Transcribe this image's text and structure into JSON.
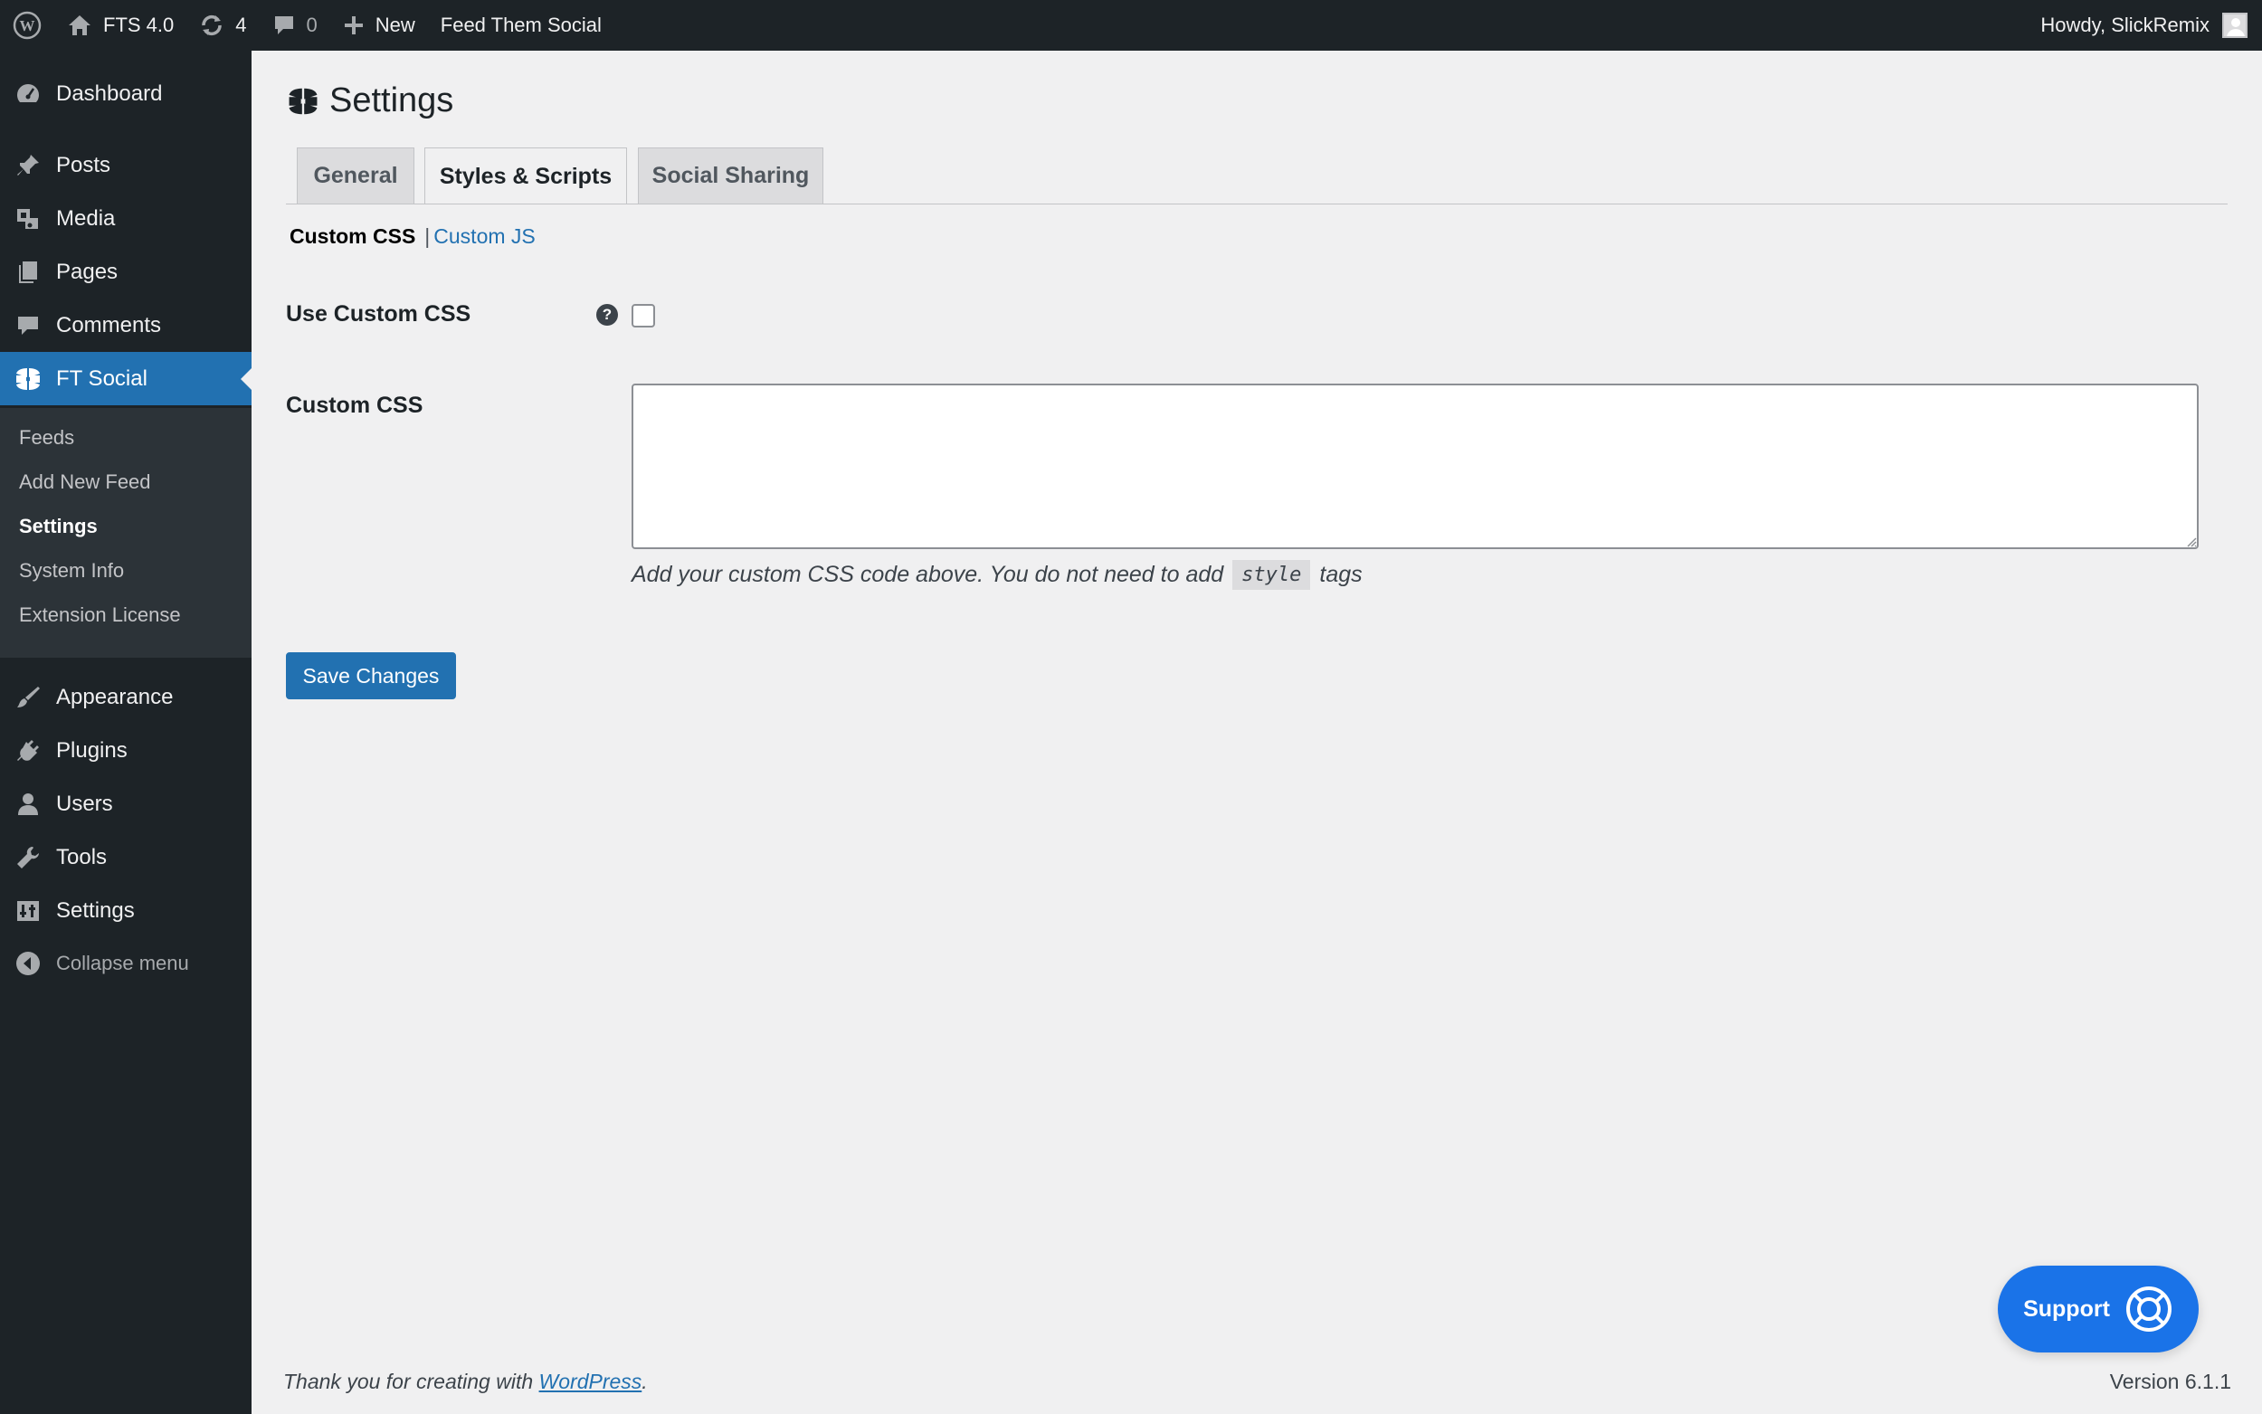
{
  "admin_bar": {
    "site_name": "FTS 4.0",
    "updates_count": "4",
    "comments_count": "0",
    "new_label": "New",
    "plugin_link": "Feed Them Social",
    "greeting": "Howdy, SlickRemix"
  },
  "sidebar": {
    "items": [
      {
        "label": "Dashboard",
        "icon": "dashboard-icon"
      },
      {
        "label": "Posts",
        "icon": "pin-icon"
      },
      {
        "label": "Media",
        "icon": "media-icon"
      },
      {
        "label": "Pages",
        "icon": "pages-icon"
      },
      {
        "label": "Comments",
        "icon": "comment-icon"
      },
      {
        "label": "FT Social",
        "icon": "ft-social-icon"
      },
      {
        "label": "Appearance",
        "icon": "brush-icon"
      },
      {
        "label": "Plugins",
        "icon": "plug-icon"
      },
      {
        "label": "Users",
        "icon": "user-icon"
      },
      {
        "label": "Tools",
        "icon": "wrench-icon"
      },
      {
        "label": "Settings",
        "icon": "settings-icon"
      }
    ],
    "submenu": [
      "Feeds",
      "Add New Feed",
      "Settings",
      "System Info",
      "Extension License"
    ],
    "collapse_label": "Collapse menu"
  },
  "page": {
    "title": "Settings",
    "tabs": [
      "General",
      "Styles & Scripts",
      "Social Sharing"
    ],
    "active_tab": "Styles & Scripts",
    "subnav": {
      "current": "Custom CSS",
      "separator": "|",
      "link": "Custom JS"
    },
    "use_custom_css_label": "Use Custom CSS",
    "help_glyph": "?",
    "use_custom_css_checked": false,
    "custom_css_label": "Custom CSS",
    "custom_css_value": "",
    "description_before": "Add your custom CSS code above. You do not need to add",
    "description_code": "style",
    "description_after": "tags",
    "save_label": "Save Changes"
  },
  "support_button": {
    "label": "Support",
    "icon": "lifebuoy-icon"
  },
  "footer": {
    "thanks_prefix": "Thank you for creating with",
    "thanks_link": "WordPress",
    "thanks_suffix": ".",
    "version": "Version 6.1.1"
  },
  "colors": {
    "admin_bar_bg": "#1d2327",
    "accent": "#2271b1",
    "content_bg": "#f0f0f1",
    "support_button": "#1a73e8"
  }
}
